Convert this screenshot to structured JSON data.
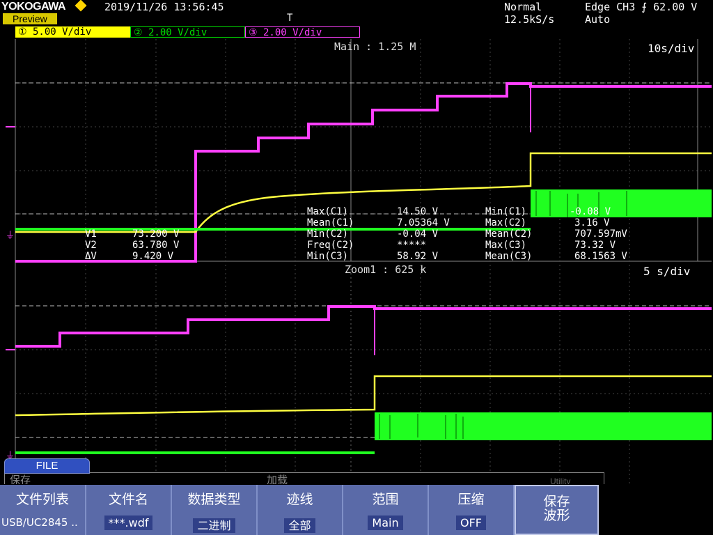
{
  "header": {
    "brand": "YOKOGAWA",
    "mode_badge": "Preview",
    "datetime": "2019/11/26  13:56:45",
    "trigger_pos_marker": "T",
    "acq_mode": "Normal",
    "sample_rate": "12.5kS/s",
    "trigger": "Edge CH3 ⨍ 62.00 V",
    "trigger_mode": "Auto"
  },
  "channels": [
    {
      "label": "① 5.00 V/div",
      "color": "#ffff00"
    },
    {
      "label": "② 2.00 V/div",
      "color": "#00e000"
    },
    {
      "label": "③ 2.00 V/div",
      "color": "#ff40ff"
    }
  ],
  "main": {
    "title": "Main : 1.25 M",
    "timebase": "10s/div"
  },
  "zoom": {
    "title": "Zoom1 : 625 k",
    "timebase": "5 s/div"
  },
  "cursors": {
    "v1_label": "V1",
    "v1_value": "73.200 V",
    "v2_label": "V2",
    "v2_value": "63.780 V",
    "dv_label": "ΔV",
    "dv_value": "9.420 V"
  },
  "measurements": [
    {
      "name": "Max(C1)",
      "value": "14.50 V"
    },
    {
      "name": "Mean(C1)",
      "value": "7.05364 V"
    },
    {
      "name": "Min(C2)",
      "value": "-0.04 V"
    },
    {
      "name": "Freq(C2)",
      "value": "*****"
    },
    {
      "name": "Min(C3)",
      "value": "58.92 V"
    },
    {
      "name": "Min(C1)",
      "value": "-0.08 V"
    },
    {
      "name": "Max(C2)",
      "value": "3.16 V"
    },
    {
      "name": "Mean(C2)",
      "value": "707.597mV"
    },
    {
      "name": "Max(C3)",
      "value": "73.32 V"
    },
    {
      "name": "Mean(C3)",
      "value": "68.1563 V"
    }
  ],
  "file_menu": {
    "tab": "FILE",
    "left_label": "保存",
    "mid_label": "加载",
    "right_label": "Utility"
  },
  "softkeys": [
    {
      "title": "文件列表",
      "value": "USB/UC2845 .."
    },
    {
      "title": "文件名",
      "value": "***.wdf"
    },
    {
      "title": "数据类型",
      "value": "二进制"
    },
    {
      "title": "迹线",
      "value": "全部"
    },
    {
      "title": "范围",
      "value": "Main"
    },
    {
      "title": "压缩",
      "value": "OFF"
    },
    {
      "title": "保存\n波形",
      "value": ""
    }
  ],
  "colors": {
    "ch1": "#ffff00",
    "ch2": "#00e000",
    "ch3": "#ff40ff",
    "softkey_bg": "#5a6aa8"
  }
}
